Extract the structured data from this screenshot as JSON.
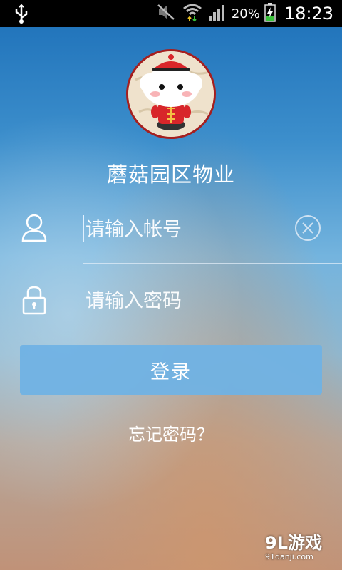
{
  "status_bar": {
    "battery_percent": "20%",
    "time": "18:23",
    "icons": [
      "usb-icon",
      "mute-icon",
      "wifi-icon",
      "signal-icon",
      "battery-charging-icon"
    ]
  },
  "app": {
    "title": "蘑菇园区物业",
    "avatar_icon": "mascot-logo-icon"
  },
  "login_form": {
    "account_placeholder": "请输入帐号",
    "password_placeholder": "请输入密码",
    "login_label": "登录",
    "forgot_label": "忘记密码？",
    "icons": [
      "user-icon",
      "clear-icon",
      "lock-icon"
    ]
  },
  "watermark": {
    "logo": "9L游戏",
    "site": "91danji.com"
  },
  "colors": {
    "button": "#70b2e4",
    "avatar_border": "#a51f1f",
    "status_bar": "#000000"
  }
}
